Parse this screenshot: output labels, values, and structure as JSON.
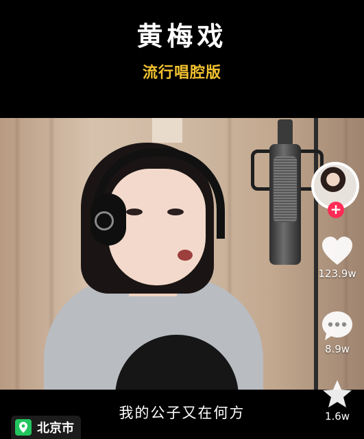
{
  "header": {
    "title": "黄梅戏",
    "subtitle": "流行唱腔版"
  },
  "lyric": "我的公子又在何方",
  "sidebar": {
    "follow_symbol": "+",
    "like_count": "123.9w",
    "comment_count": "8.9w",
    "favorite_count": "1.6w"
  },
  "location": {
    "text": "北京市",
    "icon": "location-pin-icon"
  },
  "colors": {
    "subtitle": "#f2c230",
    "follow_button": "#fe2c55",
    "location_pin": "#22c55e"
  }
}
